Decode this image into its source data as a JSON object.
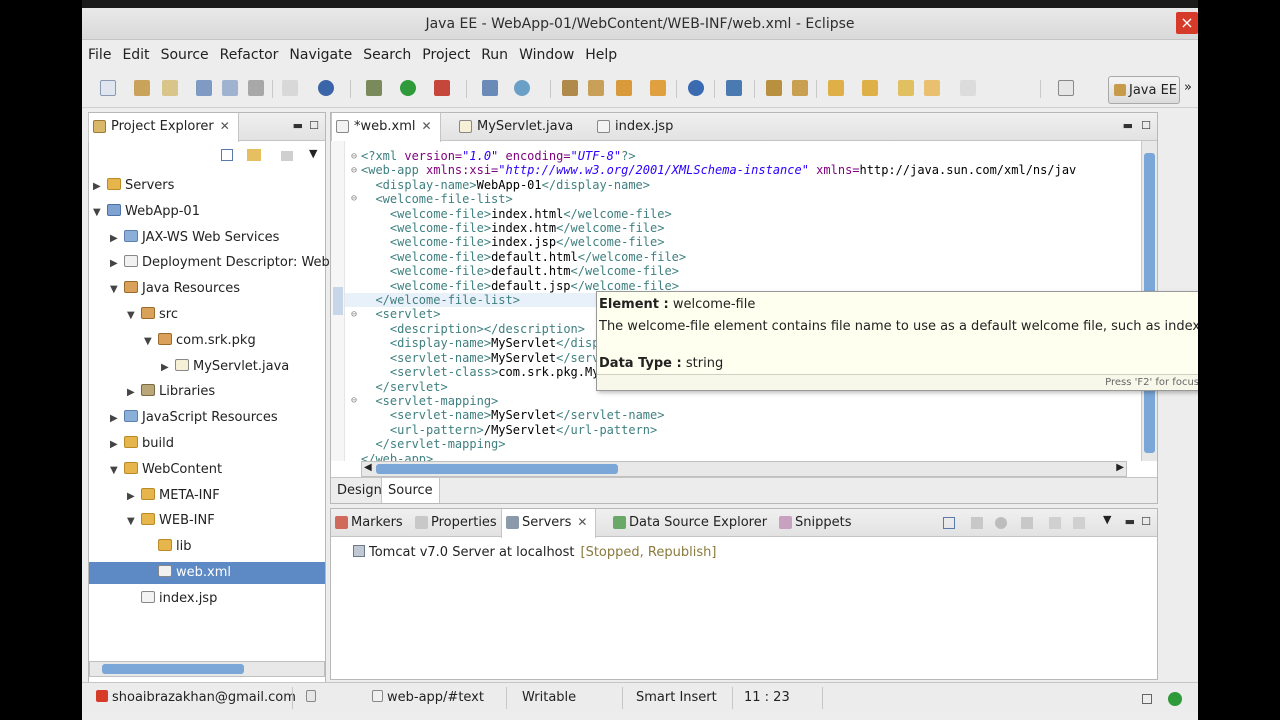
{
  "window": {
    "title": "Java EE - WebApp-01/WebContent/WEB-INF/web.xml - Eclipse",
    "close_glyph": "×"
  },
  "menu": [
    "File",
    "Edit",
    "Source",
    "Refactor",
    "Navigate",
    "Search",
    "Project",
    "Run",
    "Window",
    "Help"
  ],
  "toolbar": {
    "perspective_label": "Java EE",
    "more_glyph": "»"
  },
  "project_explorer": {
    "tab_label": "Project Explorer",
    "tree": [
      {
        "label": "Servers",
        "depth": 0,
        "twisty": "▶",
        "icon": "folder"
      },
      {
        "label": "WebApp-01",
        "depth": 0,
        "twisty": "▼",
        "icon": "proj"
      },
      {
        "label": "JAX-WS Web Services",
        "depth": 1,
        "twisty": "▶",
        "icon": "ws"
      },
      {
        "label": "Deployment Descriptor: Web",
        "depth": 1,
        "twisty": "▶",
        "icon": "xml"
      },
      {
        "label": "Java Resources",
        "depth": 1,
        "twisty": "▼",
        "icon": "pkg"
      },
      {
        "label": "src",
        "depth": 2,
        "twisty": "▼",
        "icon": "pkg"
      },
      {
        "label": "com.srk.pkg",
        "depth": 3,
        "twisty": "▼",
        "icon": "pkg"
      },
      {
        "label": "MyServlet.java",
        "depth": 4,
        "twisty": "▶",
        "icon": "java"
      },
      {
        "label": "Libraries",
        "depth": 2,
        "twisty": "▶",
        "icon": "lib"
      },
      {
        "label": "JavaScript Resources",
        "depth": 1,
        "twisty": "▶",
        "icon": "ws"
      },
      {
        "label": "build",
        "depth": 1,
        "twisty": "▶",
        "icon": "folder"
      },
      {
        "label": "WebContent",
        "depth": 1,
        "twisty": "▼",
        "icon": "folder"
      },
      {
        "label": "META-INF",
        "depth": 2,
        "twisty": "▶",
        "icon": "folder"
      },
      {
        "label": "WEB-INF",
        "depth": 2,
        "twisty": "▼",
        "icon": "folder"
      },
      {
        "label": "lib",
        "depth": 3,
        "twisty": "",
        "icon": "folder"
      },
      {
        "label": "web.xml",
        "depth": 3,
        "twisty": "",
        "icon": "xml",
        "selected": true
      },
      {
        "label": "index.jsp",
        "depth": 2,
        "twisty": "",
        "icon": "jsp"
      }
    ]
  },
  "editor": {
    "tabs": [
      {
        "label": "*web.xml",
        "active": true
      },
      {
        "label": "MyServlet.java",
        "active": false
      },
      {
        "label": "index.jsp",
        "active": false
      }
    ],
    "lines": [
      "<?xml version=\"1.0\" encoding=\"UTF-8\"?>",
      "<web-app xmlns:xsi=\"http://www.w3.org/2001/XMLSchema-instance\" xmlns=\"http://java.sun.com/xml/ns/jav",
      "  <display-name>WebApp-01</display-name>",
      "  <welcome-file-list>",
      "    <welcome-file>index.html</welcome-file>",
      "    <welcome-file>index.htm</welcome-file>",
      "    <welcome-file>index.jsp</welcome-file>",
      "    <welcome-file>default.html</welcome-file>",
      "    <welcome-file>default.htm</welcome-file>",
      "    <welcome-file>default.jsp</welcome-file>",
      "  </welcome-file-list>",
      "  <servlet>",
      "    <description></description>",
      "    <display-name>MyServlet</display-name>",
      "    <servlet-name>MyServlet</servlet-name>",
      "    <servlet-class>com.srk.pkg.MyServlet</servlet-class>",
      "  </servlet>",
      "  <servlet-mapping>",
      "    <servlet-name>MyServlet</servlet-name>",
      "    <url-pattern>/MyServlet</url-pattern>",
      "  </servlet-mapping>",
      "</web-app>"
    ],
    "bottom_tabs": [
      "Design",
      "Source"
    ],
    "active_bottom_tab": "Source"
  },
  "tooltip": {
    "element_label": "Element :",
    "element_value": "welcome-file",
    "description": "The welcome-file element contains file name to use as a default welcome file, such as index.html",
    "datatype_label": "Data Type :",
    "datatype_value": "string",
    "footer": "Press 'F2' for focus"
  },
  "bottom_panel": {
    "tabs": [
      {
        "label": "Markers",
        "active": false
      },
      {
        "label": "Properties",
        "active": false
      },
      {
        "label": "Servers",
        "active": true
      },
      {
        "label": "Data Source Explorer",
        "active": false
      },
      {
        "label": "Snippets",
        "active": false
      }
    ],
    "server": {
      "name": "Tomcat v7.0 Server at localhost",
      "status": "[Stopped, Republish]"
    }
  },
  "statusbar": {
    "user": "shoaibrazakhan@gmail.com",
    "path": "web-app/#text",
    "mode": "Writable",
    "insert": "Smart Insert",
    "position": "11 : 23"
  },
  "colors": {
    "selection": "#5d8ac5",
    "tag": "#3f7f7f",
    "attr": "#7f007f",
    "value": "#2a00ff"
  }
}
